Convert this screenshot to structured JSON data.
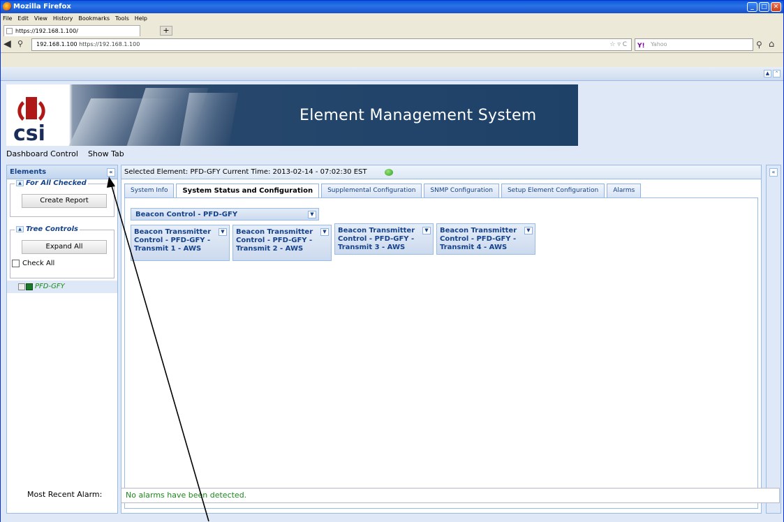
{
  "browser": {
    "title": "Mozilla Firefox",
    "menu": [
      "File",
      "Edit",
      "View",
      "History",
      "Bookmarks",
      "Tools",
      "Help"
    ],
    "tab_title": "https://192.168.1.100/",
    "url_host": "192.168.1.100",
    "url": "https://192.168.1.100",
    "search_placeholder": "Yahoo",
    "search_engine": "Y!"
  },
  "banner": {
    "logo_text": "csi",
    "title": "Element Management System"
  },
  "toolbar": {
    "dashboard_label": "Dashboard Control",
    "show_tab_label": "Show Tab"
  },
  "elements_panel": {
    "title": "Elements",
    "for_all_checked": {
      "legend": "For All Checked",
      "create_report": "Create Report"
    },
    "tree_controls": {
      "legend": "Tree Controls",
      "expand_all": "Expand All",
      "check_all": "Check All"
    },
    "tree_node": "PFD-GFY"
  },
  "main": {
    "selected_label": "Selected Element:",
    "selected_value": "PFD-GFY",
    "time_label": "Current Time:",
    "time_value": "2013-02-14 - 07:02:30 EST",
    "status_color": "#2c9d1f",
    "tabs": [
      {
        "label": "System Info"
      },
      {
        "label": "System Status and Configuration"
      },
      {
        "label": "Supplemental Configuration"
      },
      {
        "label": "SNMP Configuration"
      },
      {
        "label": "Setup Element Configuration"
      },
      {
        "label": "Alarms"
      }
    ],
    "active_tab": 1,
    "beacon_control": "Beacon Control - PFD-GFY",
    "transmitters": [
      {
        "label": "Beacon Transmitter Control - PFD-GFY - Transmit 1 - AWS"
      },
      {
        "label": "Beacon Transmitter Control - PFD-GFY - Transmit 2 - AWS"
      },
      {
        "label": "Beacon Transmitter Control - PFD-GFY - Transmit 3 - AWS"
      },
      {
        "label": "Beacon Transmitter Control - PFD-GFY - Transmit 4 - AWS"
      }
    ]
  },
  "alarm": {
    "label": "Most Recent Alarm:",
    "value": "No alarms have been detected."
  }
}
